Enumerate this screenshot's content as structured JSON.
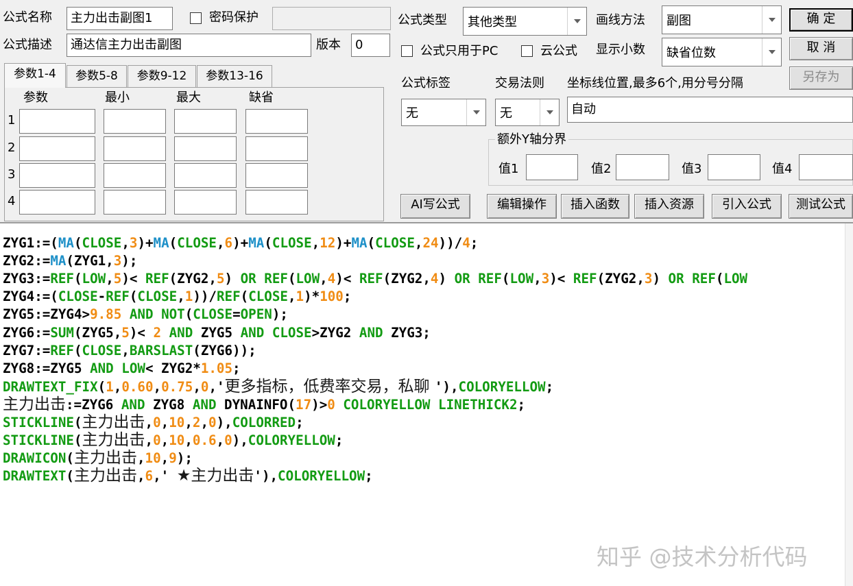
{
  "form": {
    "name_label": "公式名称",
    "name_value": "主力出击副图1",
    "password_label": "密码保护",
    "password_value": "",
    "desc_label": "公式描述",
    "desc_value": "通达信主力出击副图",
    "version_label": "版本",
    "version_value": "0",
    "type_label": "公式类型",
    "type_value": "其他类型",
    "draw_label": "画线方法",
    "draw_value": "副图",
    "pc_only_label": "公式只用于PC",
    "cloud_label": "云公式",
    "decimals_label": "显示小数",
    "decimals_value": "缺省位数",
    "tag_label": "公式标签",
    "tag_value": "无",
    "trade_label": "交易法则",
    "trade_value": "无",
    "axis_label": "坐标线位置,最多6个,用分号分隔",
    "axis_value": "自动",
    "extra_y_label": "额外Y轴分界",
    "val1_label": "值1",
    "val2_label": "值2",
    "val3_label": "值3",
    "val4_label": "值4"
  },
  "buttons": {
    "ok": "确  定",
    "cancel": "取  消",
    "save_as": "另存为",
    "ai": "AI写公式",
    "edit": "编辑操作",
    "insert_func": "插入函数",
    "insert_res": "插入资源",
    "import": "引入公式",
    "test": "测试公式"
  },
  "tabs": [
    "参数1-4",
    "参数5-8",
    "参数9-12",
    "参数13-16"
  ],
  "params": {
    "headers": [
      "参数",
      "最小",
      "最大",
      "缺省"
    ],
    "rows": [
      "1",
      "2",
      "3",
      "4"
    ]
  },
  "code": [
    [
      [
        "b",
        "ZYG1:=("
      ],
      [
        "f",
        "MA"
      ],
      [
        "b",
        "("
      ],
      [
        "g",
        "CLOSE"
      ],
      [
        "b",
        ","
      ],
      [
        "n",
        "3"
      ],
      [
        "b",
        ")+"
      ],
      [
        "f",
        "MA"
      ],
      [
        "b",
        "("
      ],
      [
        "g",
        "CLOSE"
      ],
      [
        "b",
        ","
      ],
      [
        "n",
        "6"
      ],
      [
        "b",
        ")+"
      ],
      [
        "f",
        "MA"
      ],
      [
        "b",
        "("
      ],
      [
        "g",
        "CLOSE"
      ],
      [
        "b",
        ","
      ],
      [
        "n",
        "12"
      ],
      [
        "b",
        ")+"
      ],
      [
        "f",
        "MA"
      ],
      [
        "b",
        "("
      ],
      [
        "g",
        "CLOSE"
      ],
      [
        "b",
        ","
      ],
      [
        "n",
        "24"
      ],
      [
        "b",
        "))/"
      ],
      [
        "n",
        "4"
      ],
      [
        "b",
        ";"
      ]
    ],
    [
      [
        "b",
        "ZYG2:="
      ],
      [
        "f",
        "MA"
      ],
      [
        "b",
        "(ZYG1,"
      ],
      [
        "n",
        "3"
      ],
      [
        "b",
        ");"
      ]
    ],
    [
      [
        "b",
        "ZYG3:="
      ],
      [
        "g",
        "REF"
      ],
      [
        "b",
        "("
      ],
      [
        "g",
        "LOW"
      ],
      [
        "b",
        ","
      ],
      [
        "n",
        "5"
      ],
      [
        "b",
        ")< "
      ],
      [
        "g",
        "REF"
      ],
      [
        "b",
        "(ZYG2,"
      ],
      [
        "n",
        "5"
      ],
      [
        "b",
        ") "
      ],
      [
        "g",
        "OR"
      ],
      [
        "b",
        " "
      ],
      [
        "g",
        "REF"
      ],
      [
        "b",
        "("
      ],
      [
        "g",
        "LOW"
      ],
      [
        "b",
        ","
      ],
      [
        "n",
        "4"
      ],
      [
        "b",
        ")< "
      ],
      [
        "g",
        "REF"
      ],
      [
        "b",
        "(ZYG2,"
      ],
      [
        "n",
        "4"
      ],
      [
        "b",
        ") "
      ],
      [
        "g",
        "OR"
      ],
      [
        "b",
        " "
      ],
      [
        "g",
        "REF"
      ],
      [
        "b",
        "("
      ],
      [
        "g",
        "LOW"
      ],
      [
        "b",
        ","
      ],
      [
        "n",
        "3"
      ],
      [
        "b",
        ")< "
      ],
      [
        "g",
        "REF"
      ],
      [
        "b",
        "(ZYG2,"
      ],
      [
        "n",
        "3"
      ],
      [
        "b",
        ") "
      ],
      [
        "g",
        "OR"
      ],
      [
        "b",
        " "
      ],
      [
        "g",
        "REF"
      ],
      [
        "b",
        "("
      ],
      [
        "g",
        "LOW"
      ]
    ],
    [
      [
        "b",
        "ZYG4:=("
      ],
      [
        "g",
        "CLOSE"
      ],
      [
        "b",
        "-"
      ],
      [
        "g",
        "REF"
      ],
      [
        "b",
        "("
      ],
      [
        "g",
        "CLOSE"
      ],
      [
        "b",
        ","
      ],
      [
        "n",
        "1"
      ],
      [
        "b",
        "))/"
      ],
      [
        "g",
        "REF"
      ],
      [
        "b",
        "("
      ],
      [
        "g",
        "CLOSE"
      ],
      [
        "b",
        ","
      ],
      [
        "n",
        "1"
      ],
      [
        "b",
        ")*"
      ],
      [
        "n",
        "100"
      ],
      [
        "b",
        ";"
      ]
    ],
    [
      [
        "b",
        "ZYG5:=ZYG4>"
      ],
      [
        "n",
        "9.85"
      ],
      [
        "b",
        " "
      ],
      [
        "g",
        "AND"
      ],
      [
        "b",
        " "
      ],
      [
        "g",
        "NOT"
      ],
      [
        "b",
        "("
      ],
      [
        "g",
        "CLOSE"
      ],
      [
        "b",
        "="
      ],
      [
        "g",
        "OPEN"
      ],
      [
        "b",
        ");"
      ]
    ],
    [
      [
        "b",
        "ZYG6:="
      ],
      [
        "g",
        "SUM"
      ],
      [
        "b",
        "(ZYG5,"
      ],
      [
        "n",
        "5"
      ],
      [
        "b",
        ")< "
      ],
      [
        "n",
        "2"
      ],
      [
        "b",
        " "
      ],
      [
        "g",
        "AND"
      ],
      [
        "b",
        " ZYG5 "
      ],
      [
        "g",
        "AND"
      ],
      [
        "b",
        " "
      ],
      [
        "g",
        "CLOSE"
      ],
      [
        "b",
        ">ZYG2 "
      ],
      [
        "g",
        "AND"
      ],
      [
        "b",
        " ZYG3;"
      ]
    ],
    [
      [
        "b",
        "ZYG7:="
      ],
      [
        "g",
        "REF"
      ],
      [
        "b",
        "("
      ],
      [
        "g",
        "CLOSE"
      ],
      [
        "b",
        ","
      ],
      [
        "g",
        "BARSLAST"
      ],
      [
        "b",
        "(ZYG6));"
      ]
    ],
    [
      [
        "b",
        "ZYG8:=ZYG5 "
      ],
      [
        "g",
        "AND"
      ],
      [
        "b",
        " "
      ],
      [
        "g",
        "LOW"
      ],
      [
        "b",
        "< ZYG2*"
      ],
      [
        "n",
        "1.05"
      ],
      [
        "b",
        ";"
      ]
    ],
    [
      [
        "g",
        "DRAWTEXT_FIX"
      ],
      [
        "b",
        "("
      ],
      [
        "n",
        "1"
      ],
      [
        "b",
        ","
      ],
      [
        "n",
        "0.60"
      ],
      [
        "b",
        ","
      ],
      [
        "n",
        "0.75"
      ],
      [
        "b",
        ","
      ],
      [
        "n",
        "0"
      ],
      [
        "b",
        ",'"
      ],
      [
        "c",
        "更多指标，低费率交易，私聊 "
      ],
      [
        "b",
        "'),"
      ],
      [
        "g",
        "COLORYELLOW"
      ],
      [
        "b",
        ";"
      ]
    ],
    [
      [
        "c",
        "主力出击"
      ],
      [
        "b",
        ":=ZYG6 "
      ],
      [
        "g",
        "AND"
      ],
      [
        "b",
        " ZYG8 "
      ],
      [
        "g",
        "AND"
      ],
      [
        "b",
        " DYNAINFO("
      ],
      [
        "n",
        "17"
      ],
      [
        "b",
        ")>"
      ],
      [
        "n",
        "0"
      ],
      [
        "b",
        " "
      ],
      [
        "g",
        "COLORYELLOW"
      ],
      [
        "b",
        " "
      ],
      [
        "g",
        "LINETHICK2"
      ],
      [
        "b",
        ";"
      ]
    ],
    [
      [
        "g",
        "STICKLINE"
      ],
      [
        "b",
        "("
      ],
      [
        "c",
        "主力出击"
      ],
      [
        "b",
        ","
      ],
      [
        "n",
        "0"
      ],
      [
        "b",
        ","
      ],
      [
        "n",
        "10"
      ],
      [
        "b",
        ","
      ],
      [
        "n",
        "2"
      ],
      [
        "b",
        ","
      ],
      [
        "n",
        "0"
      ],
      [
        "b",
        "),"
      ],
      [
        "g",
        "COLORRED"
      ],
      [
        "b",
        ";"
      ]
    ],
    [
      [
        "g",
        "STICKLINE"
      ],
      [
        "b",
        "("
      ],
      [
        "c",
        "主力出击"
      ],
      [
        "b",
        ","
      ],
      [
        "n",
        "0"
      ],
      [
        "b",
        ","
      ],
      [
        "n",
        "10"
      ],
      [
        "b",
        ","
      ],
      [
        "n",
        "0.6"
      ],
      [
        "b",
        ","
      ],
      [
        "n",
        "0"
      ],
      [
        "b",
        "),"
      ],
      [
        "g",
        "COLORYELLOW"
      ],
      [
        "b",
        ";"
      ]
    ],
    [
      [
        "g",
        "DRAWICON"
      ],
      [
        "b",
        "("
      ],
      [
        "c",
        "主力出击"
      ],
      [
        "b",
        ","
      ],
      [
        "n",
        "10"
      ],
      [
        "b",
        ","
      ],
      [
        "n",
        "9"
      ],
      [
        "b",
        ");"
      ]
    ],
    [
      [
        "g",
        "DRAWTEXT"
      ],
      [
        "b",
        "("
      ],
      [
        "c",
        "主力出击"
      ],
      [
        "b",
        ","
      ],
      [
        "n",
        "6"
      ],
      [
        "b",
        ",' "
      ],
      [
        "c",
        "★主力出击"
      ],
      [
        "b",
        "'),"
      ],
      [
        "g",
        "COLORYELLOW"
      ],
      [
        "b",
        ";"
      ]
    ]
  ],
  "watermark": "知乎 @技术分析代码",
  "colors": {
    "keyword_green": "#139b13",
    "function_blue": "#1e90c8",
    "number_orange": "#f08c14"
  }
}
